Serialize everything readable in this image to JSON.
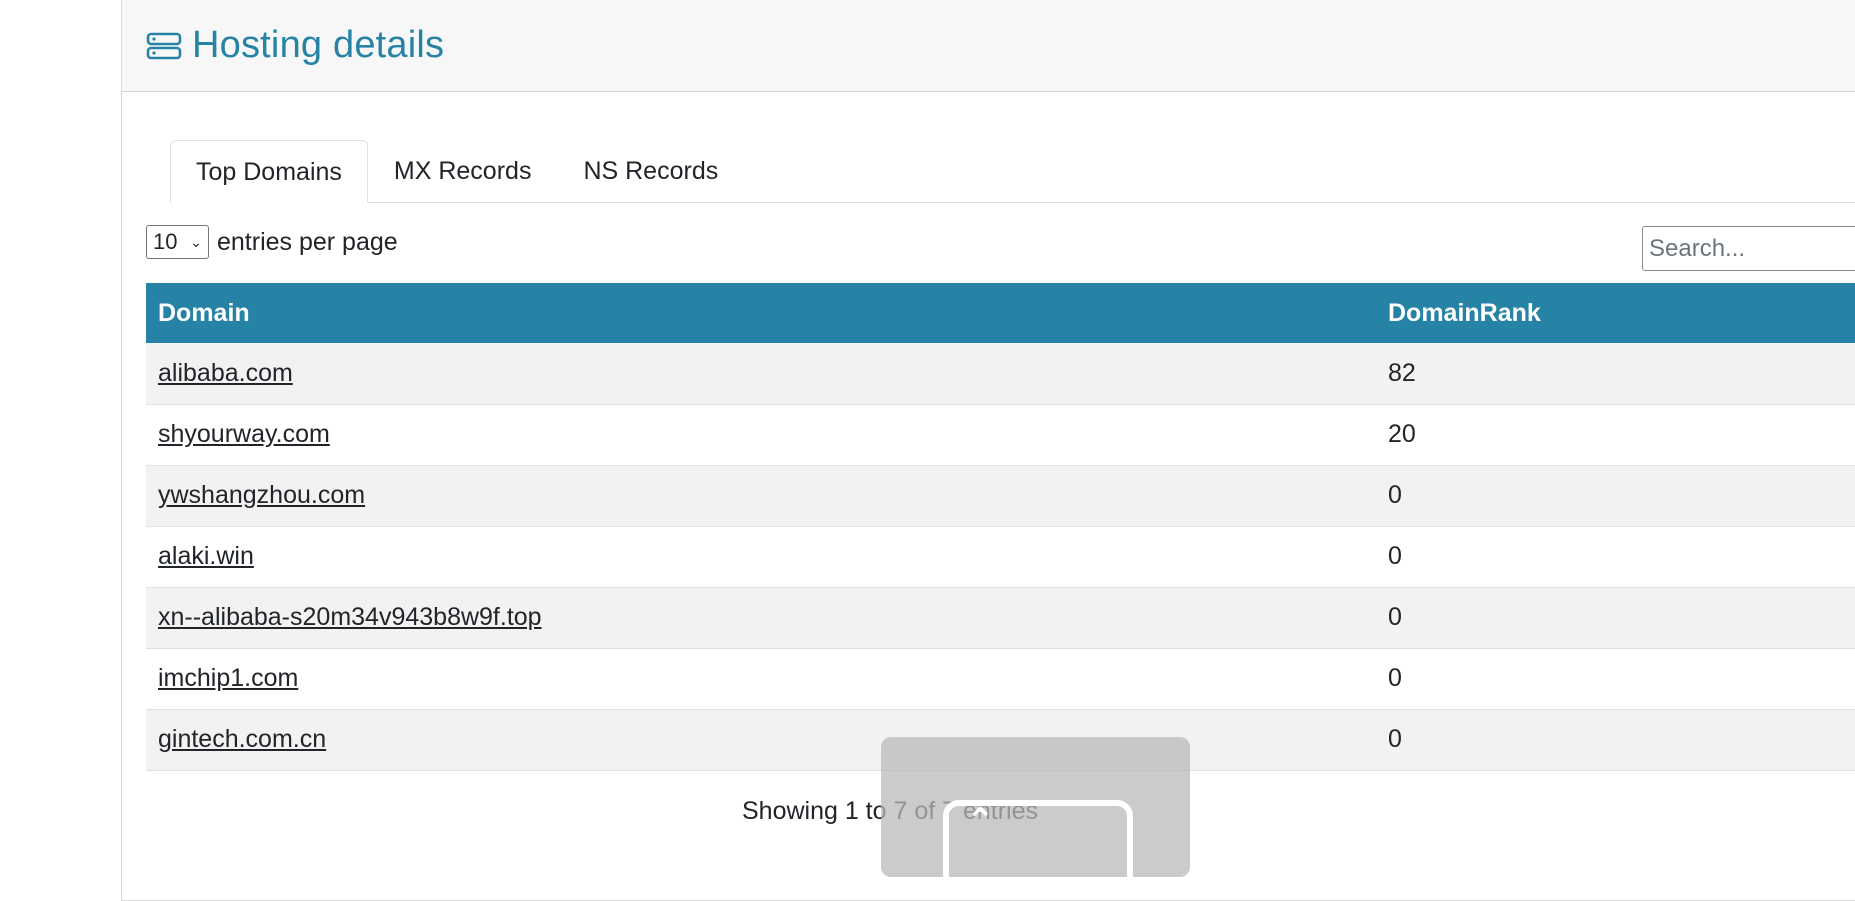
{
  "header": {
    "title": "Hosting details",
    "icon": "server-icon"
  },
  "tabs": [
    {
      "label": "Top Domains",
      "active": true
    },
    {
      "label": "MX Records",
      "active": false
    },
    {
      "label": "NS Records",
      "active": false
    }
  ],
  "controls": {
    "per_page_value": "10",
    "per_page_label": "entries per page",
    "search_placeholder": "Search..."
  },
  "table": {
    "columns": [
      "Domain",
      "DomainRank"
    ],
    "rows": [
      {
        "domain": "alibaba.com",
        "rank": "82"
      },
      {
        "domain": "shyourway.com",
        "rank": "20"
      },
      {
        "domain": "ywshangzhou.com",
        "rank": "0"
      },
      {
        "domain": "alaki.win",
        "rank": "0"
      },
      {
        "domain": "xn--alibaba-s20m34v943b8w9f.top",
        "rank": "0"
      },
      {
        "domain": "imchip1.com",
        "rank": "0"
      },
      {
        "domain": "gintech.com.cn",
        "rank": "0"
      }
    ]
  },
  "footer": {
    "info": "Showing 1 to 7 of 7 entries"
  },
  "colors": {
    "accent": "#2783a6",
    "row_alt": "#f2f2f2"
  }
}
